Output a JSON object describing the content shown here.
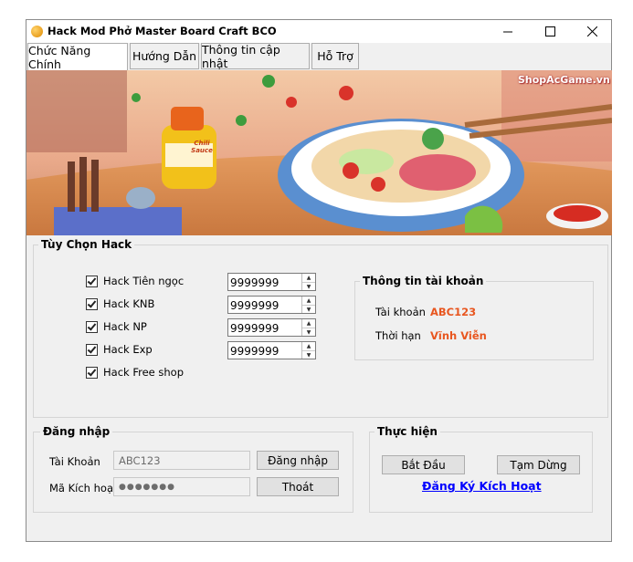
{
  "window": {
    "title": "Hack Mod Phở Master Board Craft BCO"
  },
  "tabs": [
    {
      "label": "Chức Năng Chính"
    },
    {
      "label": "Hướng Dẫn"
    },
    {
      "label": "Thông tin cập nhật"
    },
    {
      "label": "Hỗ Trợ"
    }
  ],
  "banner": {
    "watermark": "ShopAcGame.vn",
    "sauce_label": "Chili Sauce"
  },
  "hack_options": {
    "title": "Tùy Chọn Hack",
    "items": [
      {
        "label": "Hack Tiên ngọc",
        "checked": true,
        "value": "9999999"
      },
      {
        "label": "Hack KNB",
        "checked": true,
        "value": "9999999"
      },
      {
        "label": "Hack NP",
        "checked": true,
        "value": "9999999"
      },
      {
        "label": "Hack Exp",
        "checked": true,
        "value": "9999999"
      },
      {
        "label": "Hack Free shop",
        "checked": true
      }
    ]
  },
  "account_info": {
    "title": "Thông tin tài khoản",
    "account_label": "Tài khoản",
    "account_value": "ABC123",
    "term_label": "Thời hạn",
    "term_value": "Vĩnh Viễn",
    "accent_color": "#e8561f"
  },
  "login": {
    "title": "Đăng nhập",
    "account_label": "Tài Khoản",
    "account_value": "ABC123",
    "code_label": "Mã Kích hoạt",
    "code_value": "●●●●●●●",
    "login_button": "Đăng nhập",
    "exit_button": "Thoát"
  },
  "execute": {
    "title": "Thực hiện",
    "start_button": "Bắt Đầu",
    "pause_button": "Tạm Dừng",
    "register_link": "Đăng Ký Kích Hoạt"
  }
}
